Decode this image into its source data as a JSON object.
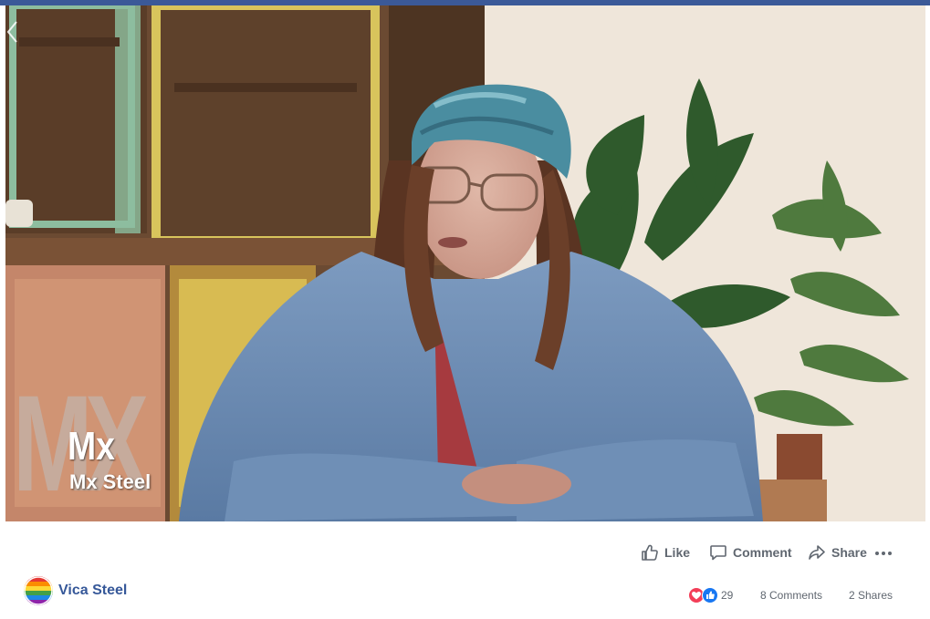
{
  "video": {
    "overlay_watermark": "MX",
    "overlay_title": "Mx",
    "overlay_subtitle": "Mx Steel"
  },
  "actions": {
    "like_label": "Like",
    "comment_label": "Comment",
    "share_label": "Share"
  },
  "post": {
    "author_name": "Vica Steel",
    "reaction_count": "29",
    "comments_label": "8 Comments",
    "shares_label": "2 Shares"
  },
  "icons": {
    "back": "chevron-left-icon",
    "like": "thumbs-up-icon",
    "comment": "speech-bubble-icon",
    "share": "share-arrow-icon",
    "more": "more-dots-icon",
    "reaction_love": "heart-reaction-icon",
    "reaction_like": "like-reaction-icon"
  },
  "colors": {
    "brand": "#3b5998",
    "author_link": "#365899",
    "action_text": "#606770",
    "love_reaction": "#f33e58",
    "like_reaction": "#1877f2"
  }
}
